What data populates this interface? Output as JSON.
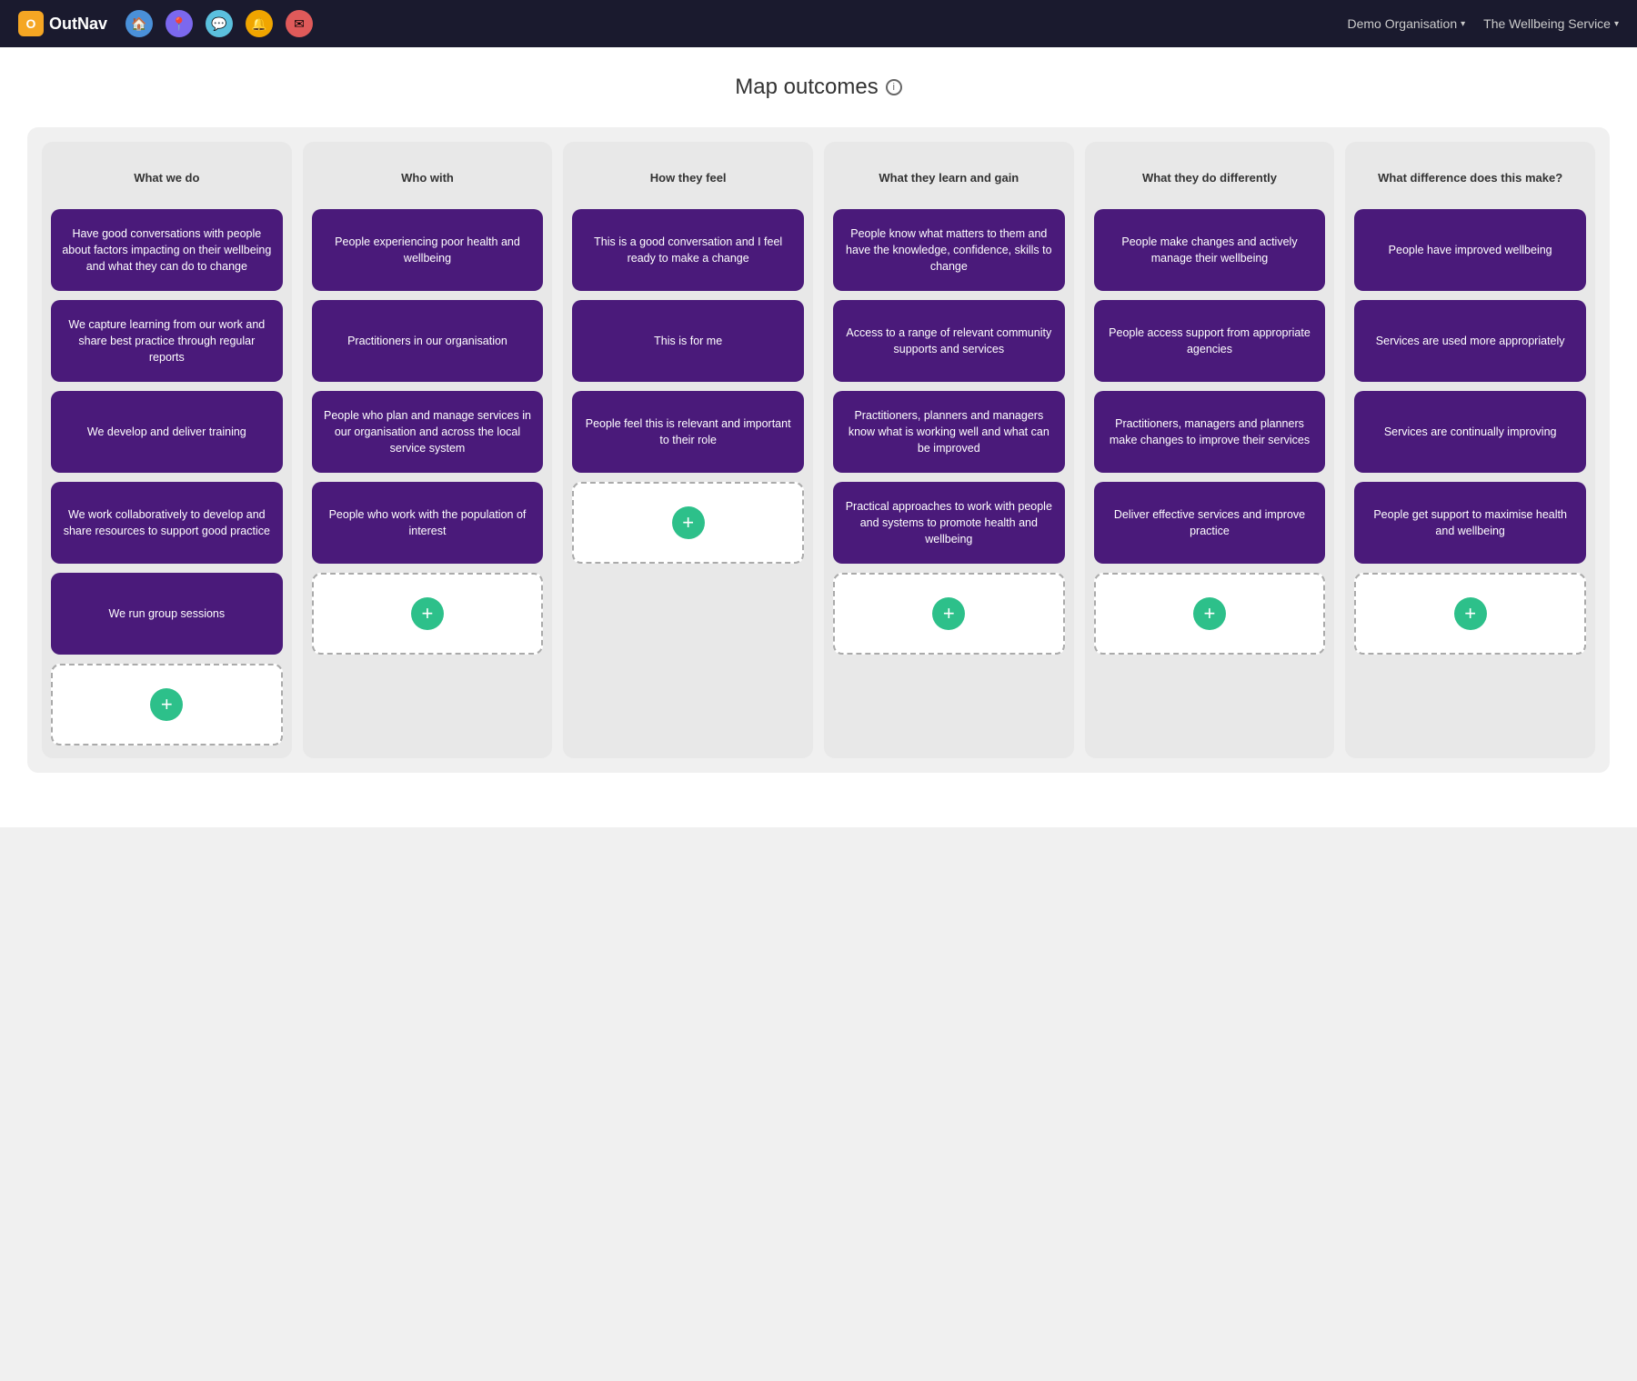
{
  "navbar": {
    "logo_text": "OutNav",
    "icons": [
      {
        "name": "home-icon",
        "color": "blue",
        "symbol": "🏠"
      },
      {
        "name": "location-icon",
        "color": "purple",
        "symbol": "📍"
      },
      {
        "name": "chat-icon",
        "color": "blue2",
        "symbol": "💬"
      },
      {
        "name": "alert-icon",
        "color": "orange",
        "symbol": "🔔"
      },
      {
        "name": "mail-icon",
        "color": "red",
        "symbol": "✉"
      }
    ],
    "menu_items": [
      {
        "label": "Demo Organisation",
        "name": "demo-org-menu"
      },
      {
        "label": "The Wellbeing Service",
        "name": "wellbeing-service-menu"
      }
    ]
  },
  "page": {
    "title": "Map outcomes",
    "info_icon_label": "ⓘ"
  },
  "columns": [
    {
      "id": "what-we-do",
      "header": "What we do",
      "cards": [
        "Have good conversations with people about factors impacting on their wellbeing and what they can do to change",
        "We capture learning from our work and share best practice through regular reports",
        "We develop and deliver training",
        "We work collaboratively to develop and share resources to support good practice",
        "We run group sessions"
      ],
      "has_add": true
    },
    {
      "id": "who-with",
      "header": "Who with",
      "cards": [
        "People experiencing poor health and wellbeing",
        "Practitioners in our organisation",
        "People who plan and manage services in our organisation and across the local service system",
        "People who work with the population of interest"
      ],
      "has_add": true
    },
    {
      "id": "how-they-feel",
      "header": "How they feel",
      "cards": [
        "This is a good conversation and I feel ready to make a change",
        "This is for me",
        "People feel this is relevant and important to their role"
      ],
      "has_add": true
    },
    {
      "id": "what-they-learn",
      "header": "What they learn and gain",
      "cards": [
        "People know what matters to them and have the knowledge, confidence, skills to change",
        "Access to a range of relevant community supports and services",
        "Practitioners, planners and managers know what is working well and what can be improved",
        "Practical approaches to work with people and systems to promote health and wellbeing"
      ],
      "has_add": true
    },
    {
      "id": "what-they-do",
      "header": "What they do differently",
      "cards": [
        "People make changes and actively manage their wellbeing",
        "People access support from appropriate agencies",
        "Practitioners, managers and planners make changes to improve their services",
        "Deliver effective services and improve practice"
      ],
      "has_add": true
    },
    {
      "id": "what-difference",
      "header": "What difference does this make?",
      "cards": [
        "People have improved wellbeing",
        "Services are used more appropriately",
        "Services are continually improving",
        "People get support to maximise health and wellbeing"
      ],
      "has_add": true
    }
  ]
}
